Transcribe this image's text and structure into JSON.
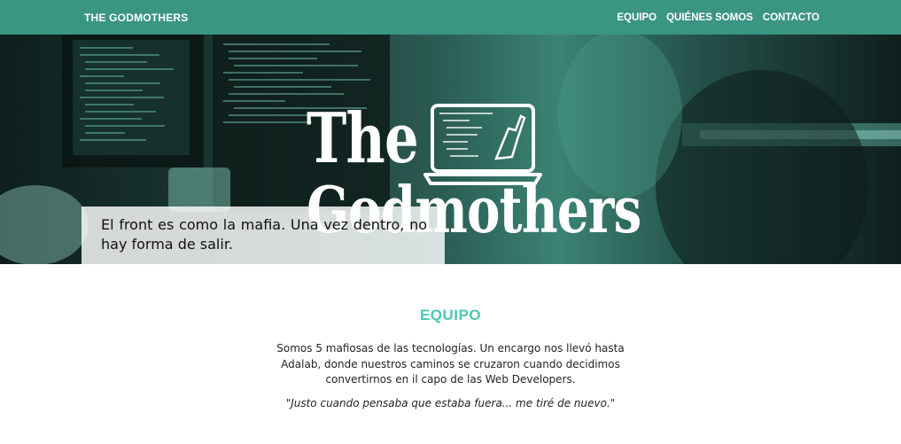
{
  "header": {
    "brand": "THE GODMOTHERS",
    "nav": [
      "EQUIPO",
      "QUIÉNES SOMOS",
      "CONTACTO"
    ]
  },
  "hero": {
    "logo_line1": "The",
    "logo_line2": "Godmothers",
    "quote": "El front es como la mafia. Una vez dentro, no hay forma de salir."
  },
  "equipo": {
    "title": "EQUIPO",
    "description": "Somos 5 mafiosas de las tecnologías. Un encargo nos llevó hasta Adalab, donde nuestros caminos se cruzaron cuando decidimos convertirnos en il capo de las Web Developers.",
    "quote": "\"Justo cuando pensaba que estaba fuera... me tiré de nuevo.\""
  },
  "colors": {
    "header_bg": "#3a9583",
    "accent": "#4dc6b2",
    "hero_tint": "#2a5a51"
  }
}
